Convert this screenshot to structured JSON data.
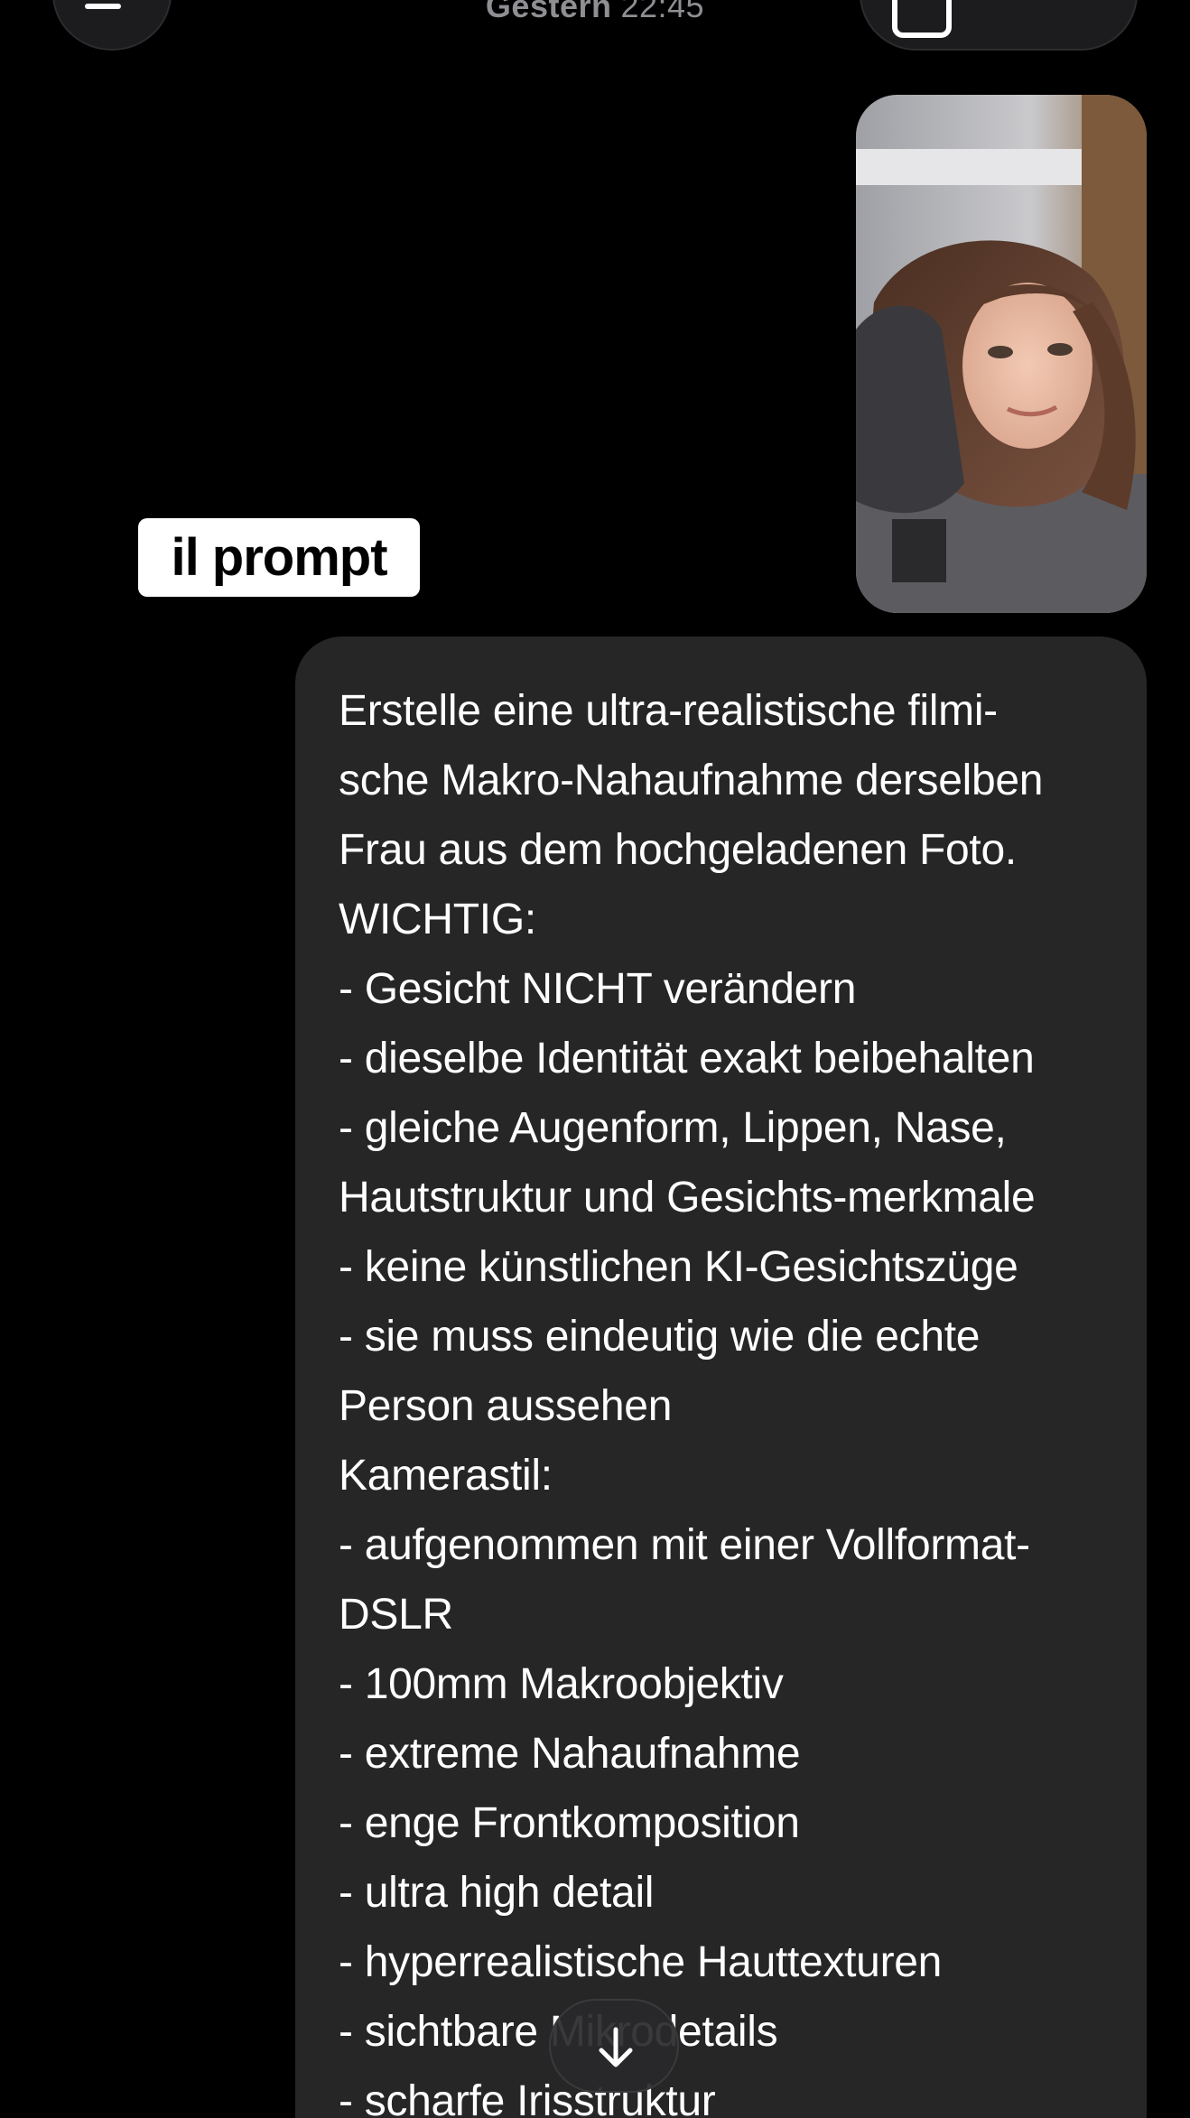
{
  "header": {
    "day": "Gestern",
    "time": "22:45"
  },
  "caption": "il prompt",
  "message": {
    "lines": [
      "Erstelle eine ultra-realistische filmi-",
      "sche Makro-Nahaufnahme derselben",
      "Frau aus dem hochgeladenen Foto.",
      "WICHTIG:",
      "- Gesicht NICHT verändern",
      "- dieselbe Identität exakt beibehalten",
      "- gleiche Augenform, Lippen, Nase,",
      "Hautstruktur und Gesichts-merkmale",
      "- keine künstlichen KI-Gesichtszüge",
      "- sie muss eindeutig wie die echte",
      "Person aussehen",
      "Kamerastil:",
      "- aufgenommen mit einer Vollformat-",
      "DSLR",
      "- 100mm Makroobjektiv",
      "- extreme Nahaufnahme",
      "- enge Frontkomposition",
      "- ultra high detail",
      "- hyperrealistische Hauttexturen",
      "- sichtbare Mikrodetails",
      "- scharfe Irisstruktur"
    ]
  },
  "icons": {
    "menu": "menu-icon",
    "new_chat": "new-chat-icon",
    "scroll_down": "arrow-down-icon"
  },
  "colors": {
    "background": "#000000",
    "bubble": "#262626",
    "caption_bg": "#ffffff",
    "timestamp": "#8e8e93"
  }
}
